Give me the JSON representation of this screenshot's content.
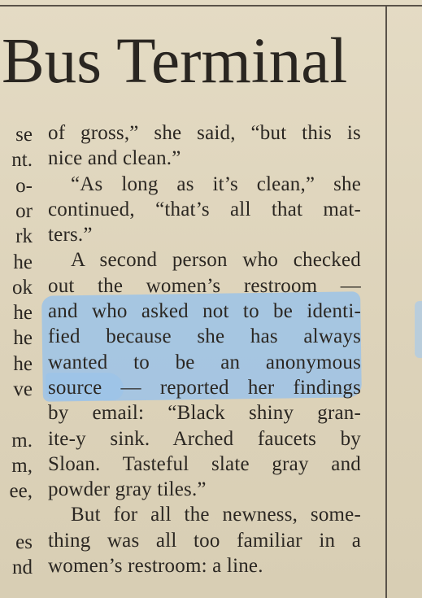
{
  "headline": "Bus Terminal",
  "left_column_fragments": [
    "se",
    "nt.",
    "o-",
    "or",
    "rk",
    "he",
    "ok",
    "he",
    "he",
    "he",
    "ve",
    "",
    "m.",
    "m,",
    "ee,",
    "",
    "es",
    "nd"
  ],
  "article_lines": [
    {
      "text": "of gross,” she said, “but this is",
      "indent": false,
      "last": false
    },
    {
      "text": "nice and clean.”",
      "indent": false,
      "last": true
    },
    {
      "text": "“As long as it’s clean,” she",
      "indent": true,
      "last": false
    },
    {
      "text": "continued, “that’s all that mat-",
      "indent": false,
      "last": false
    },
    {
      "text": "ters.”",
      "indent": false,
      "last": true
    },
    {
      "text": "A second person who checked",
      "indent": true,
      "last": false
    },
    {
      "text": "out the women’s restroom —",
      "indent": false,
      "last": false
    },
    {
      "text": "and who asked not to be identi-",
      "indent": false,
      "last": false
    },
    {
      "text": "fied because she has always",
      "indent": false,
      "last": false
    },
    {
      "text": "wanted to be an anonymous",
      "indent": false,
      "last": false
    },
    {
      "text": "source — reported her findings",
      "indent": false,
      "last": false
    },
    {
      "text": "by email: “Black shiny gran-",
      "indent": false,
      "last": false
    },
    {
      "text": "ite-y sink. Arched faucets by",
      "indent": false,
      "last": false
    },
    {
      "text": "Sloan. Tasteful slate gray and",
      "indent": false,
      "last": false
    },
    {
      "text": "powder gray tiles.”",
      "indent": false,
      "last": true
    },
    {
      "text": "But for all the newness, some-",
      "indent": true,
      "last": false
    },
    {
      "text": "thing was all too familiar in a",
      "indent": false,
      "last": false
    },
    {
      "text": "women’s restroom: a line.",
      "indent": false,
      "last": true
    }
  ],
  "colors": {
    "paper": "#e2d8c0",
    "ink": "#2b2722",
    "highlight": "#9cc3e8",
    "rule": "#5a534a"
  }
}
